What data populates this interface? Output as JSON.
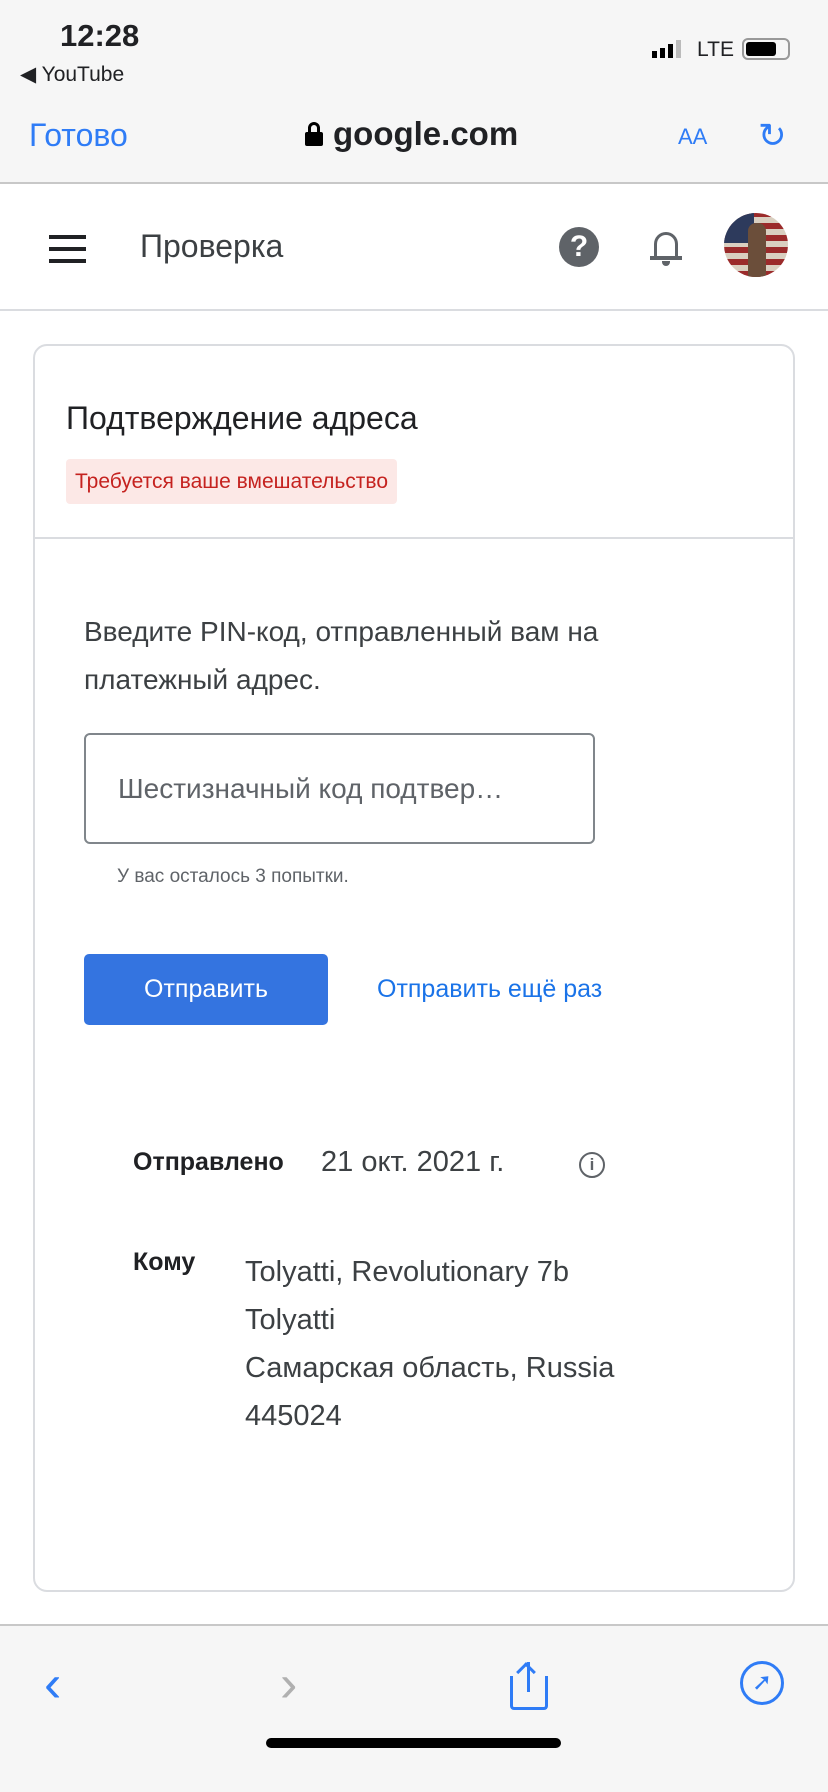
{
  "status_bar": {
    "time": "12:28",
    "back_app": "YouTube",
    "network": "LTE"
  },
  "browser": {
    "done": "Готово",
    "domain": "google.com",
    "text_size": "AA"
  },
  "header": {
    "title": "Проверка"
  },
  "card": {
    "title": "Подтверждение адреса",
    "badge": "Требуется ваше вмешательство",
    "instruction": "Введите PIN-код, отправленный вам на платежный адрес.",
    "pin_placeholder": "Шестизначный код подтвер…",
    "attempts": "У вас осталось 3 попытки.",
    "submit": "Отправить",
    "resend": "Отправить ещё раз",
    "sent_label": "Отправлено",
    "sent_date": "21 окт. 2021 г.",
    "to_label": "Кому",
    "address": [
      "Tolyatti, Revolutionary 7b",
      "Tolyatti",
      "Самарская область, Russia",
      "445024"
    ]
  },
  "colors": {
    "accent": "#2f7cf6",
    "button": "#3474e0",
    "badge_bg": "#fce8e6",
    "badge_text": "#c5221f"
  }
}
